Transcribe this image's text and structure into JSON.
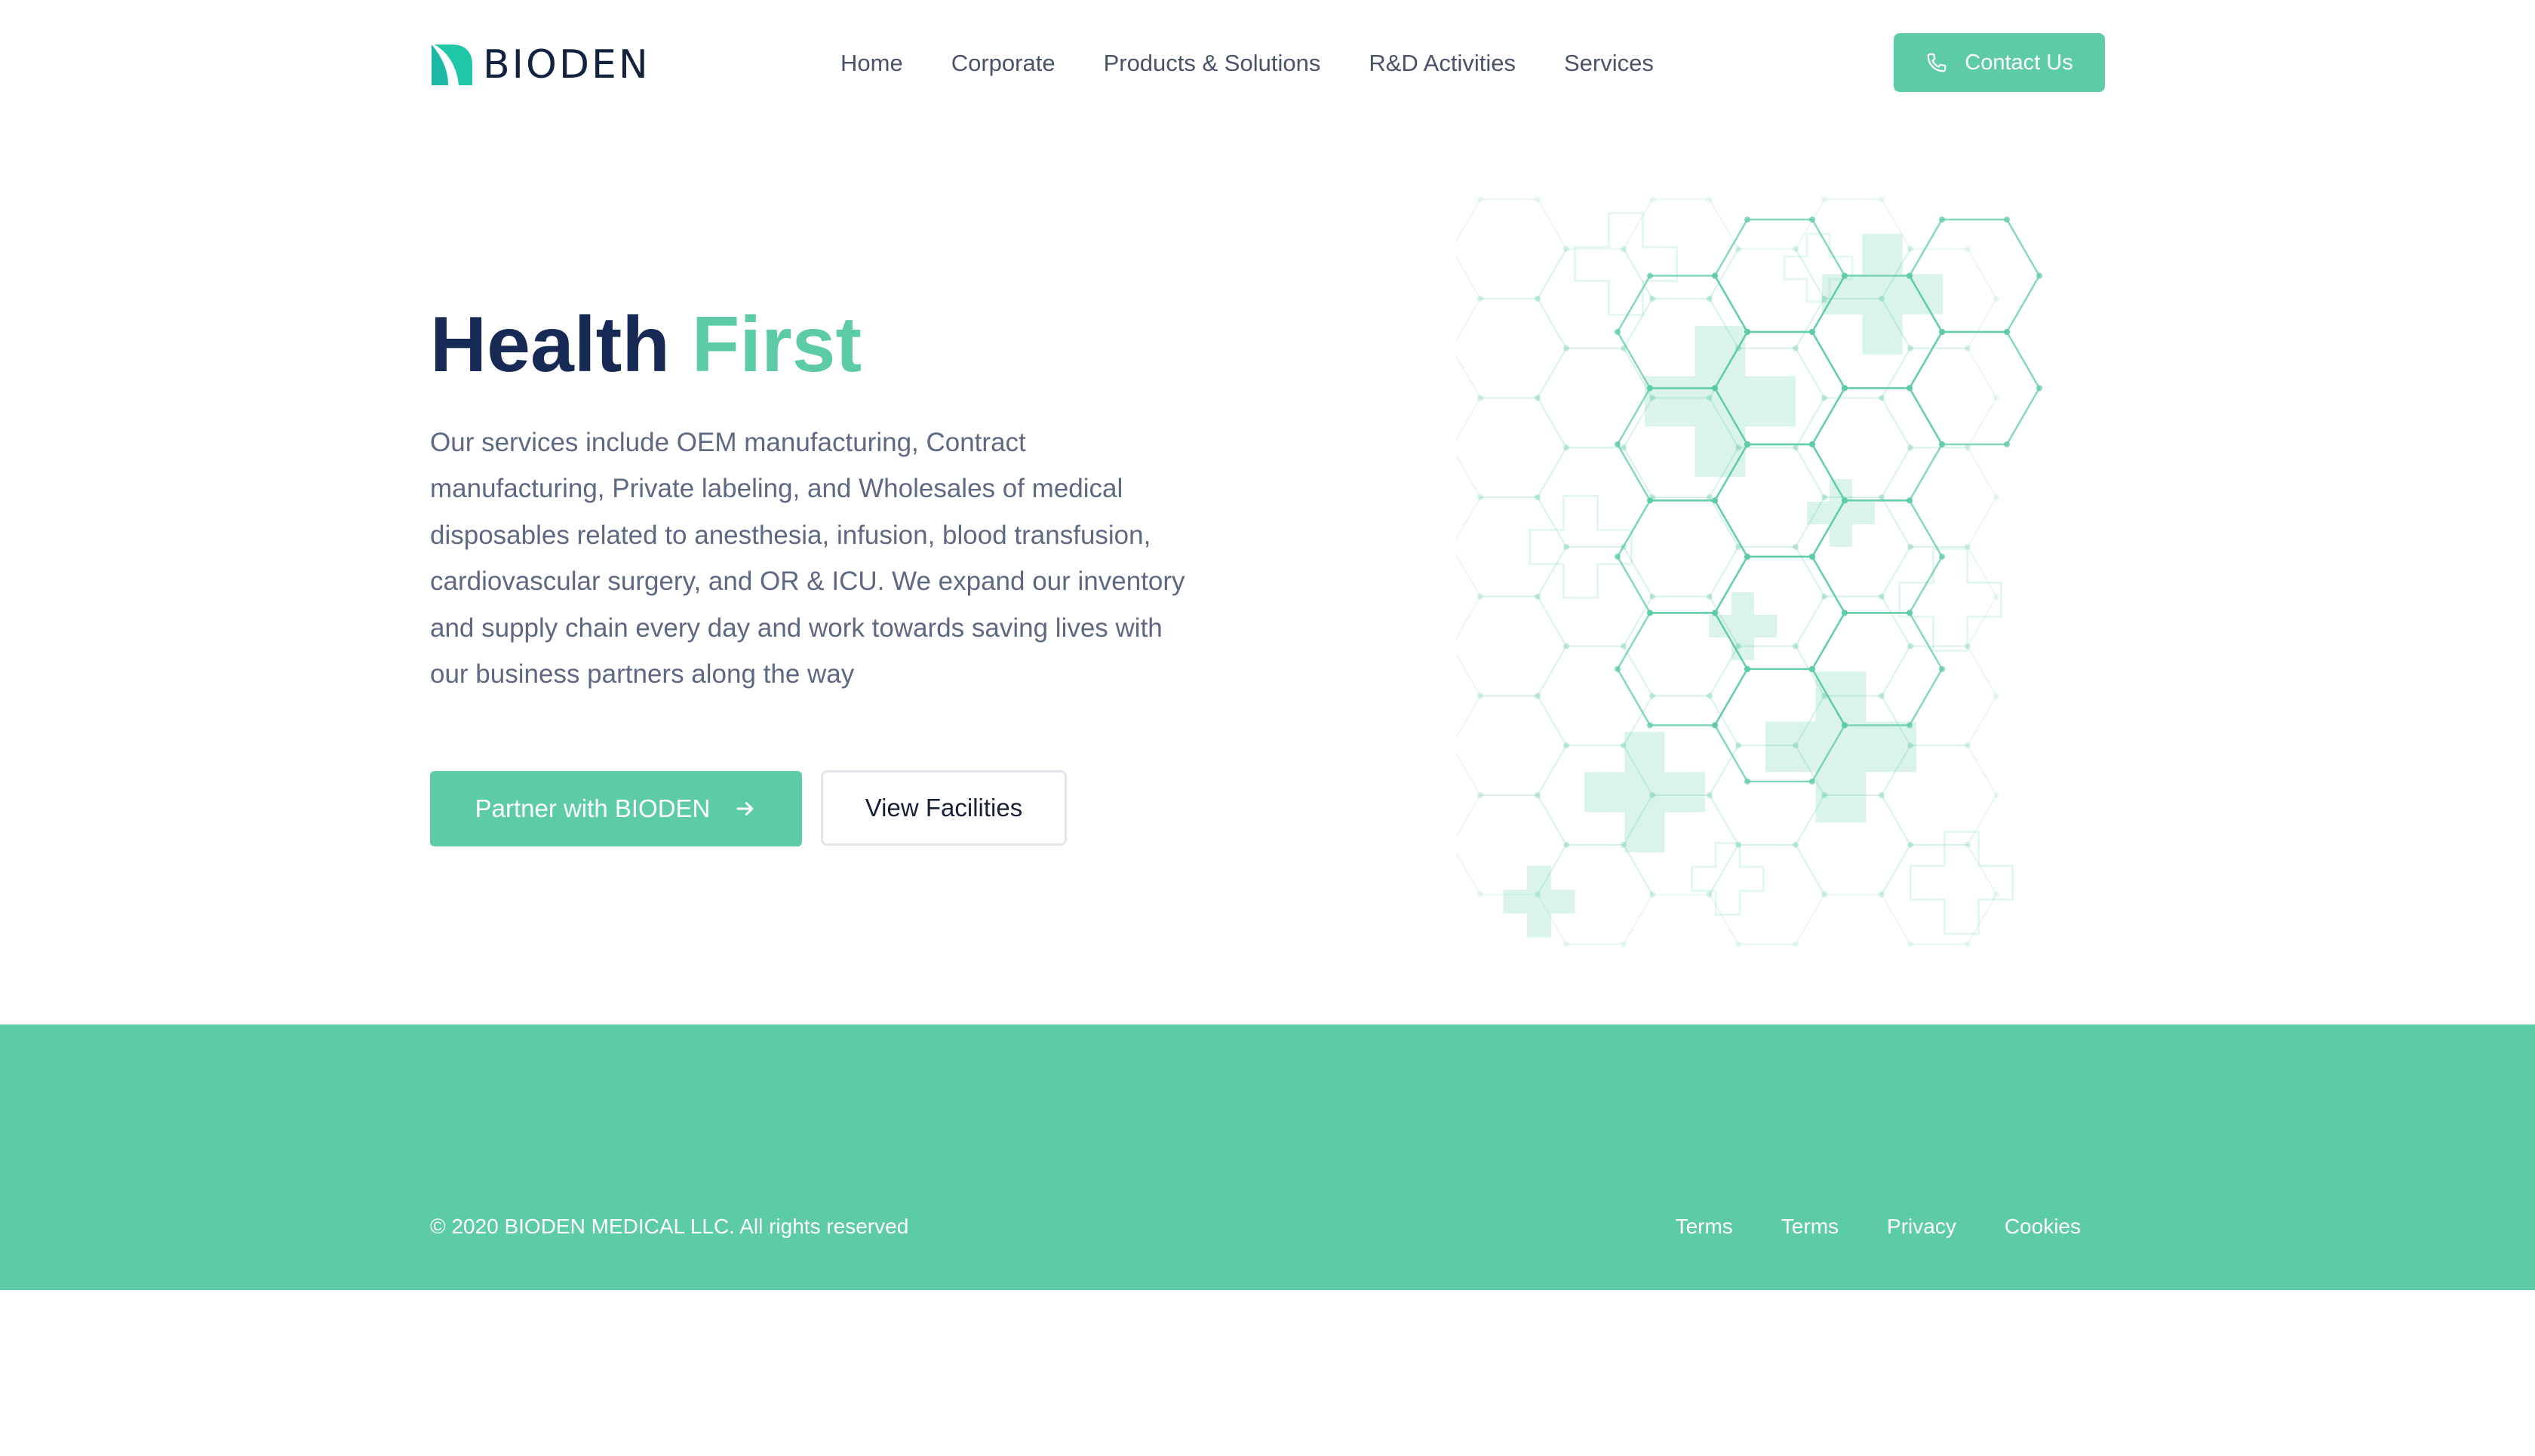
{
  "brand": {
    "name": "BIODEN",
    "accent_color": "#5ccba6",
    "dark_color": "#162a55",
    "logo_icon": "leaf-logo-icon"
  },
  "nav": {
    "items": [
      {
        "label": "Home"
      },
      {
        "label": "Corporate"
      },
      {
        "label": "Products & Solutions"
      },
      {
        "label": "R&D Activities"
      },
      {
        "label": "Services"
      }
    ],
    "contact": {
      "label": "Contact Us",
      "icon": "phone-icon"
    }
  },
  "hero": {
    "title_part1": "Health",
    "title_part2": "First",
    "description": "Our services include OEM manufacturing, Contract manufacturing, Private labeling, and Wholesales of medical disposables related to anesthesia, infusion, blood transfusion, cardiovascular surgery, and OR & ICU. We expand our inventory and supply chain every day and work towards saving lives with our business partners along the way",
    "primary_button": {
      "label": "Partner with BIODEN",
      "icon": "arrow-right-icon"
    },
    "secondary_button": {
      "label": "View Facilities"
    },
    "illustration": "hexagon-medical-cross-pattern"
  },
  "footer": {
    "background_color": "#5ccba6",
    "copyright": "© 2020 BIODEN MEDICAL LLC. All rights reserved",
    "links": [
      {
        "label": "Terms"
      },
      {
        "label": "Terms"
      },
      {
        "label": "Privacy"
      },
      {
        "label": "Cookies"
      }
    ]
  }
}
